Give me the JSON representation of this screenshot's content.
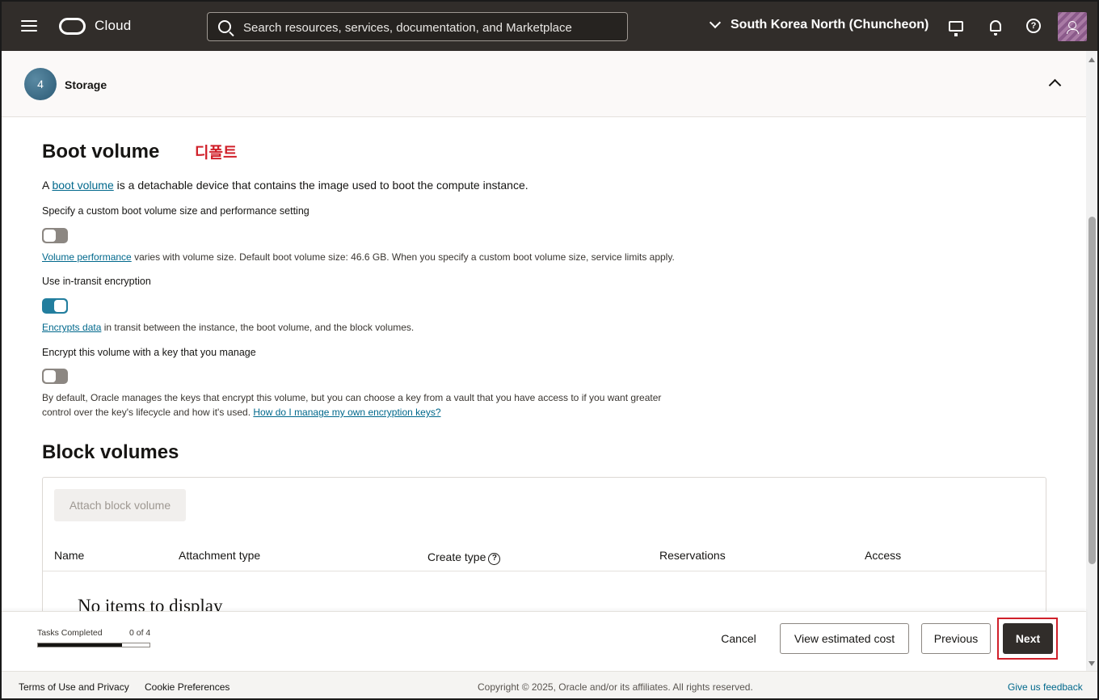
{
  "header": {
    "logo_text": "Cloud",
    "search_placeholder": "Search resources, services, documentation, and Marketplace",
    "region": "South Korea North (Chuncheon)"
  },
  "section": {
    "step_number": "4",
    "title": "Storage"
  },
  "boot_volume": {
    "heading": "Boot volume",
    "annotation": "디폴트",
    "intro_prefix": "A ",
    "intro_link": "boot volume",
    "intro_suffix": " is a detachable device that contains the image used to boot the compute instance.",
    "custom_size_label": "Specify a custom boot volume size and performance setting",
    "custom_size_enabled": false,
    "performance_link": "Volume performance",
    "performance_text": " varies with volume size. Default boot volume size: 46.6 GB. When you specify a custom boot volume size, service limits apply.",
    "transit_label": "Use in-transit encryption",
    "transit_enabled": true,
    "encrypts_link": "Encrypts data",
    "encrypts_text": " in transit between the instance, the boot volume, and the block volumes.",
    "own_key_label": "Encrypt this volume with a key that you manage",
    "own_key_enabled": false,
    "own_key_text": "By default, Oracle manages the keys that encrypt this volume, but you can choose a key from a vault that you have access to if you want greater control over the key's lifecycle and how it's used. ",
    "own_key_link": "How do I manage my own encryption keys?"
  },
  "block_volumes": {
    "heading": "Block volumes",
    "attach_button": "Attach block volume",
    "columns": [
      "Name",
      "Attachment type",
      "Create type",
      "Reservations",
      "Access"
    ],
    "empty_text": "No items to display"
  },
  "action_bar": {
    "tasks_label": "Tasks Completed",
    "tasks_count": "0 of 4",
    "progress": 0.75,
    "cancel": "Cancel",
    "estimate": "View estimated cost",
    "previous": "Previous",
    "next": "Next"
  },
  "footer": {
    "terms": "Terms of Use and Privacy",
    "cookies": "Cookie Preferences",
    "copyright": "Copyright © 2025, Oracle and/or its affiliates. All rights reserved.",
    "feedback": "Give us feedback"
  }
}
